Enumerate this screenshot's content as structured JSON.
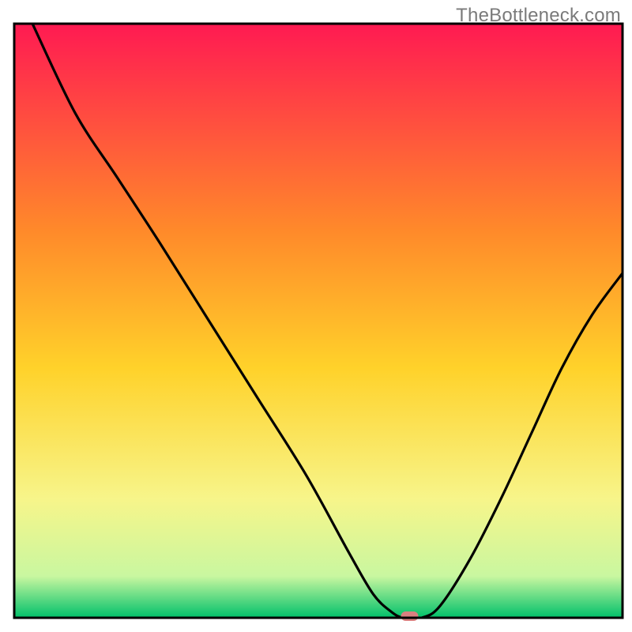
{
  "watermark": "TheBottleneck.com",
  "chart_data": {
    "type": "line",
    "title": "",
    "xlabel": "",
    "ylabel": "",
    "xlim": [
      0,
      100
    ],
    "ylim": [
      0,
      100
    ],
    "grid": false,
    "legend": false,
    "gradient_colors": {
      "top": "#ff1a52",
      "upper_mid": "#ff8a2a",
      "mid": "#ffd22a",
      "lower_mid": "#f7f58a",
      "near_bottom": "#c9f7a0",
      "bottom": "#00c06a"
    },
    "frame_color": "#000000",
    "marker": {
      "x": 65,
      "y": 0,
      "color": "#d98080",
      "shape": "rounded-rect"
    },
    "series": [
      {
        "name": "curve",
        "color": "#000000",
        "points": [
          {
            "x": 3.0,
            "y": 100.0
          },
          {
            "x": 10.0,
            "y": 85.0
          },
          {
            "x": 17.0,
            "y": 74.0
          },
          {
            "x": 24.0,
            "y": 63.0
          },
          {
            "x": 32.0,
            "y": 50.0
          },
          {
            "x": 40.0,
            "y": 37.0
          },
          {
            "x": 48.0,
            "y": 24.0
          },
          {
            "x": 55.0,
            "y": 11.0
          },
          {
            "x": 59.0,
            "y": 4.0
          },
          {
            "x": 62.0,
            "y": 1.0
          },
          {
            "x": 64.0,
            "y": 0.0
          },
          {
            "x": 67.0,
            "y": 0.0
          },
          {
            "x": 70.0,
            "y": 2.0
          },
          {
            "x": 75.0,
            "y": 10.0
          },
          {
            "x": 80.0,
            "y": 20.0
          },
          {
            "x": 85.0,
            "y": 31.0
          },
          {
            "x": 90.0,
            "y": 42.0
          },
          {
            "x": 95.0,
            "y": 51.0
          },
          {
            "x": 100.0,
            "y": 58.0
          }
        ]
      }
    ]
  }
}
